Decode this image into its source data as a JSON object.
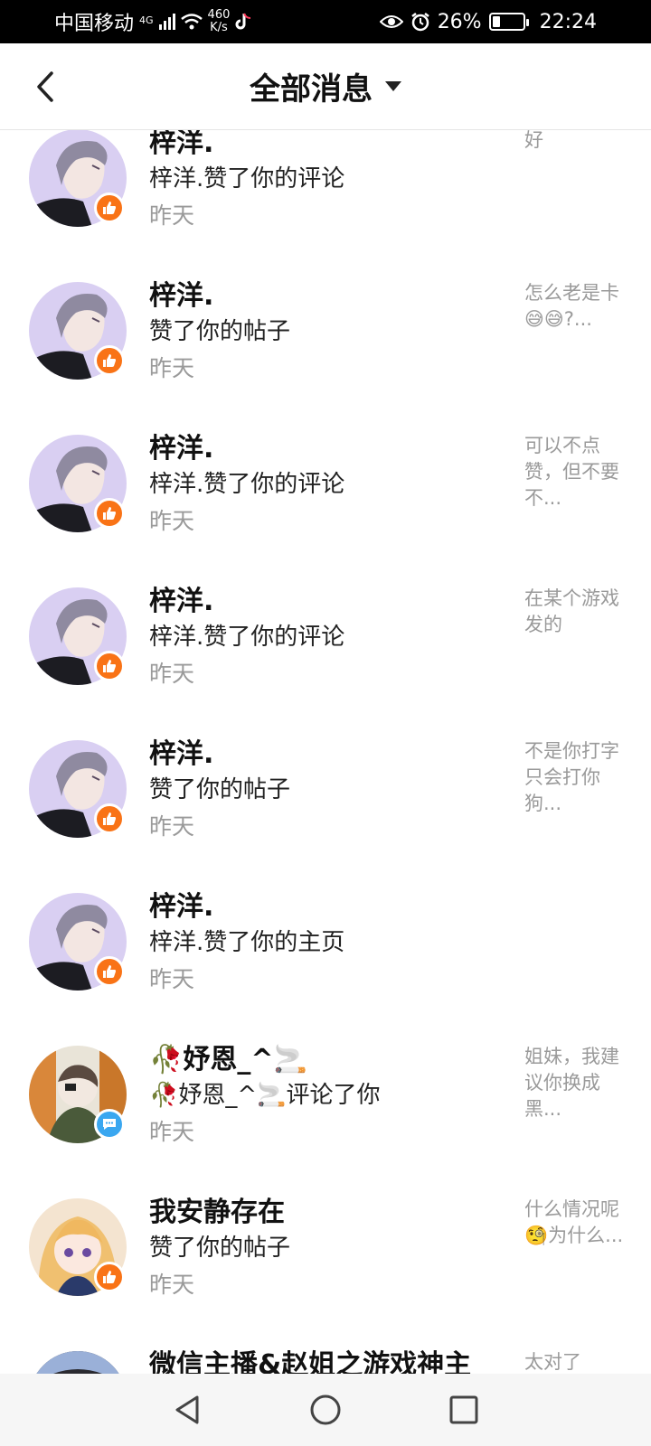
{
  "status_bar": {
    "carrier": "中国移动",
    "net_gen": "4G",
    "net_speed_value": "460",
    "net_speed_unit": "K/s",
    "battery": "26%",
    "battery_level": 0.26,
    "time": "22:24"
  },
  "header": {
    "title": "全部消息"
  },
  "messages": [
    {
      "name": "梓洋.",
      "action": "梓洋.赞了你的评论",
      "time": "昨天",
      "preview": "好",
      "badge": "like",
      "avatar": "avatar-boy"
    },
    {
      "name": "梓洋.",
      "action": "赞了你的帖子",
      "time": "昨天",
      "preview": "怎么老是卡😅😅?...",
      "badge": "like",
      "avatar": "avatar-boy"
    },
    {
      "name": "梓洋.",
      "action": "梓洋.赞了你的评论",
      "time": "昨天",
      "preview": "可以不点赞，但不要不...",
      "badge": "like",
      "avatar": "avatar-boy"
    },
    {
      "name": "梓洋.",
      "action": "梓洋.赞了你的评论",
      "time": "昨天",
      "preview": "在某个游戏发的",
      "badge": "like",
      "avatar": "avatar-boy"
    },
    {
      "name": "梓洋.",
      "action": "赞了你的帖子",
      "time": "昨天",
      "preview": "不是你打字只会打你狗...",
      "badge": "like",
      "avatar": "avatar-boy"
    },
    {
      "name": "梓洋.",
      "action": "梓洋.赞了你的主页",
      "time": "昨天",
      "preview": "",
      "badge": "like",
      "avatar": "avatar-boy"
    },
    {
      "name": "🥀妤恩_^🚬",
      "action": "🥀妤恩_^🚬评论了你",
      "time": "昨天",
      "preview": "姐妹，我建议你换成黑...",
      "badge": "comment",
      "avatar": "avatar-girl-dark"
    },
    {
      "name": "我安静存在",
      "action": "赞了你的帖子",
      "time": "昨天",
      "preview": "什么情况呢🧐为什么...",
      "badge": "like",
      "avatar": "avatar-girl-blonde"
    },
    {
      "name": "微信主播&赵姐之游戏神主",
      "action": "",
      "time": "",
      "preview": "太对了",
      "badge": "",
      "avatar": "avatar-dark"
    }
  ],
  "colors": {
    "like_badge": "#f97316",
    "comment_badge": "#3aa7f0",
    "muted_text": "#9a9a9a"
  },
  "icons": {
    "back": "chevron-left-icon",
    "dropdown": "caret-down-icon",
    "like": "thumbs-up-icon",
    "comment": "chat-bubble-icon",
    "nav_back": "triangle-back-icon",
    "nav_home": "circle-home-icon",
    "nav_recent": "square-recents-icon"
  }
}
